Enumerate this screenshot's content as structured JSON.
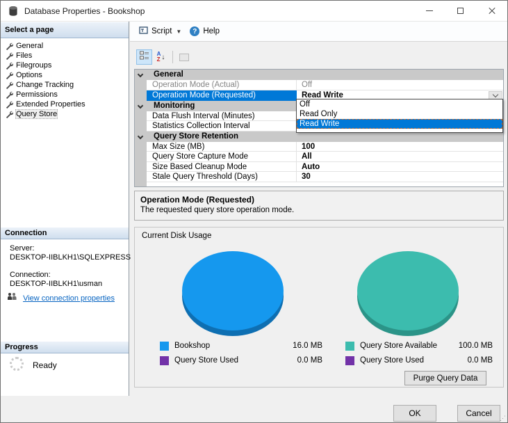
{
  "window": {
    "title": "Database Properties - Bookshop"
  },
  "sidebar": {
    "pages_header": "Select a page",
    "pages": [
      {
        "label": "General"
      },
      {
        "label": "Files"
      },
      {
        "label": "Filegroups"
      },
      {
        "label": "Options"
      },
      {
        "label": "Change Tracking"
      },
      {
        "label": "Permissions"
      },
      {
        "label": "Extended Properties"
      },
      {
        "label": "Query Store"
      }
    ],
    "connection_header": "Connection",
    "server_label": "Server:",
    "server_value": "DESKTOP-IIBLKH1\\SQLEXPRESS",
    "connection_label": "Connection:",
    "connection_value": "DESKTOP-IIBLKH1\\usman",
    "view_connection_link": "View connection properties",
    "progress_header": "Progress",
    "progress_status": "Ready"
  },
  "toolbar": {
    "script_label": "Script",
    "help_label": "Help"
  },
  "icons": {
    "help_glyph": "?",
    "script_dropdown": "▼",
    "sort_a": "A",
    "sort_z": "Z",
    "sort_arrow": "↓",
    "grip": "⋰"
  },
  "grid": {
    "cat_general": "General",
    "row_op_actual": {
      "label": "Operation Mode (Actual)",
      "value": "Off"
    },
    "row_op_requested": {
      "label": "Operation Mode (Requested)",
      "value": "Read Write"
    },
    "cat_monitoring": "Monitoring",
    "row_data_flush": {
      "label": "Data Flush Interval (Minutes)"
    },
    "row_stats": {
      "label": "Statistics Collection Interval"
    },
    "cat_retention": "Query Store Retention",
    "row_max_size": {
      "label": "Max Size (MB)",
      "value": "100"
    },
    "row_capture": {
      "label": "Query Store Capture Mode",
      "value": "All"
    },
    "row_cleanup": {
      "label": "Size Based Cleanup Mode",
      "value": "Auto"
    },
    "row_stale": {
      "label": "Stale Query Threshold (Days)",
      "value": "30"
    },
    "dropdown_options": [
      "Off",
      "Read Only",
      "Read Write"
    ],
    "dropdown_selected": "Read Write"
  },
  "description": {
    "title": "Operation Mode (Requested)",
    "text": "The requested query store operation mode."
  },
  "disk_usage": {
    "title": "Current Disk Usage",
    "left_chart": {
      "slices": [
        {
          "label": "Bookshop",
          "value_mb": 16.0,
          "color": "#1598ee"
        },
        {
          "label": "Query Store Used",
          "value_mb": 0.0,
          "color": "#7232a8"
        }
      ],
      "legend": [
        {
          "label": "Bookshop",
          "value": "16.0 MB"
        },
        {
          "label": "Query Store Used",
          "value": "0.0 MB"
        }
      ]
    },
    "right_chart": {
      "slices": [
        {
          "label": "Query Store Available",
          "value_mb": 100.0,
          "color": "#3cbcae"
        },
        {
          "label": "Query Store Used",
          "value_mb": 0.0,
          "color": "#7232a8"
        }
      ],
      "legend": [
        {
          "label": "Query Store Available",
          "value": "100.0 MB"
        },
        {
          "label": "Query Store Used",
          "value": "0.0 MB"
        }
      ]
    },
    "purge_button": "Purge Query Data"
  },
  "footer": {
    "ok": "OK",
    "cancel": "Cancel"
  },
  "colors": {
    "selection": "#0078d7",
    "pie_blue": "#1598ee",
    "pie_teal": "#3cbcae",
    "legend_purple": "#7232a8",
    "link": "#0563c1"
  }
}
